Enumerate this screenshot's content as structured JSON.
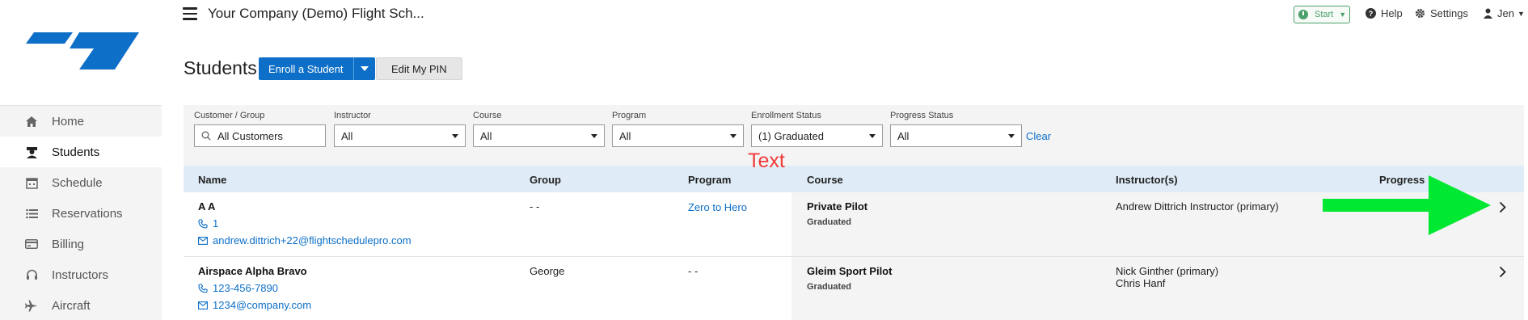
{
  "app": {
    "company_title": "Your Company (Demo) Flight Sch...",
    "start_label": "Start",
    "help_label": "Help",
    "settings_label": "Settings",
    "user_label": "Jen"
  },
  "sidebar": {
    "items": [
      {
        "label": "Home",
        "icon": "home-icon"
      },
      {
        "label": "Students",
        "icon": "student-icon",
        "active": true
      },
      {
        "label": "Schedule",
        "icon": "calendar-icon"
      },
      {
        "label": "Reservations",
        "icon": "list-icon"
      },
      {
        "label": "Billing",
        "icon": "billing-icon"
      },
      {
        "label": "Instructors",
        "icon": "headset-icon"
      },
      {
        "label": "Aircraft",
        "icon": "airplane-icon"
      }
    ]
  },
  "page": {
    "title": "Students",
    "enroll_label": "Enroll a Student",
    "pin_label": "Edit My PIN"
  },
  "filters": {
    "customer": {
      "label": "Customer / Group",
      "value": "All Customers"
    },
    "instructor": {
      "label": "Instructor",
      "value": "All"
    },
    "course": {
      "label": "Course",
      "value": "All"
    },
    "program": {
      "label": "Program",
      "value": "All"
    },
    "enrollment": {
      "label": "Enrollment Status",
      "value": "(1) Graduated"
    },
    "progress": {
      "label": "Progress Status",
      "value": "All"
    },
    "clear_label": "Clear"
  },
  "annotation": {
    "text": "Text",
    "color": "#f03a3a",
    "arrow_color": "#00e832"
  },
  "table": {
    "headers": {
      "name": "Name",
      "group": "Group",
      "program": "Program",
      "course": "Course",
      "instructors": "Instructor(s)",
      "progress": "Progress"
    },
    "rows": [
      {
        "name": "A A",
        "phone": "1",
        "email": "andrew.dittrich+22@flightschedulepro.com",
        "group": "- -",
        "program": "Zero to Hero",
        "course": "Private Pilot",
        "status": "Graduated",
        "instructor1": "Andrew Dittrich Instructor (primary)",
        "instructor2": ""
      },
      {
        "name": "Airspace Alpha Bravo",
        "phone": "123-456-7890",
        "email": "1234@company.com",
        "group": "George",
        "program": "- -",
        "course": "Gleim Sport Pilot",
        "status": "Graduated",
        "instructor1": "Nick Ginther (primary)",
        "instructor2": "Chris Hanf"
      }
    ]
  },
  "colors": {
    "accent": "#0d6fc7",
    "start_green": "#4ca06a",
    "header_bg": "#dfecf7"
  }
}
